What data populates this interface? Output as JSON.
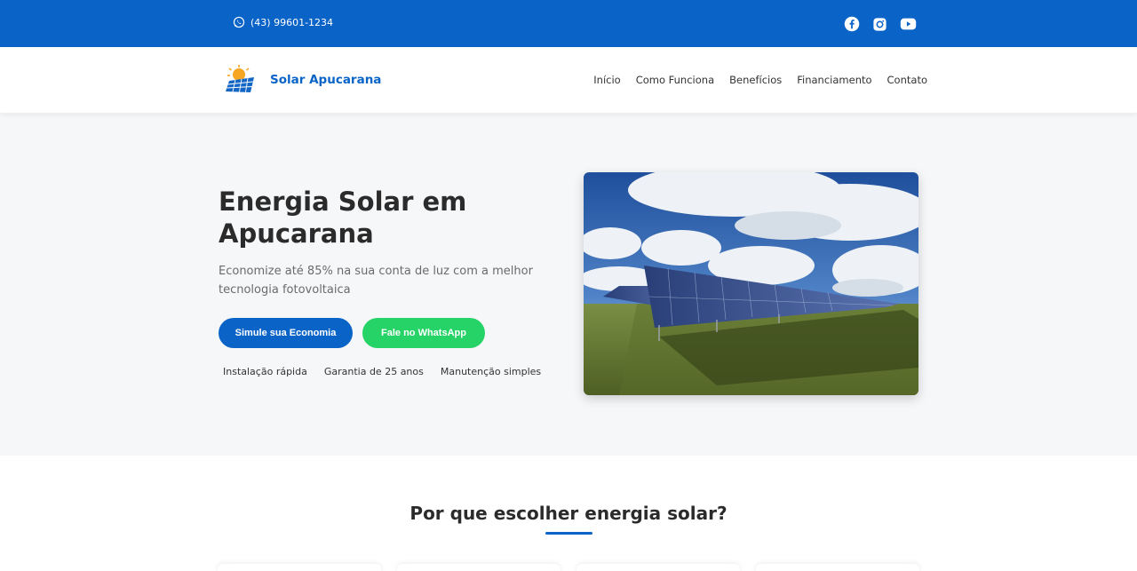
{
  "topbar": {
    "phone": "(43) 99601-1234",
    "icons": [
      "whatsapp-icon",
      "facebook-icon",
      "instagram-icon",
      "youtube-icon"
    ]
  },
  "nav": {
    "brand": "Solar Apucarana",
    "links": [
      "Início",
      "Como Funciona",
      "Benefícios",
      "Financiamento",
      "Contato"
    ]
  },
  "hero": {
    "title": "Energia Solar em Apucarana",
    "subtitle": "Economize até 85% na sua conta de luz com a melhor tecnologia fotovoltaica",
    "primary_button": "Simule sua Economia",
    "whatsapp_button": "Fale no WhatsApp",
    "features": [
      "Instalação rápida",
      "Garantia de 25 anos",
      "Manutenção simples"
    ]
  },
  "section": {
    "title": "Por que escolher energia solar?"
  },
  "colors": {
    "brand_blue": "#0a64c8",
    "whatsapp_green": "#25d366",
    "hero_bg": "#f6f7f9"
  }
}
